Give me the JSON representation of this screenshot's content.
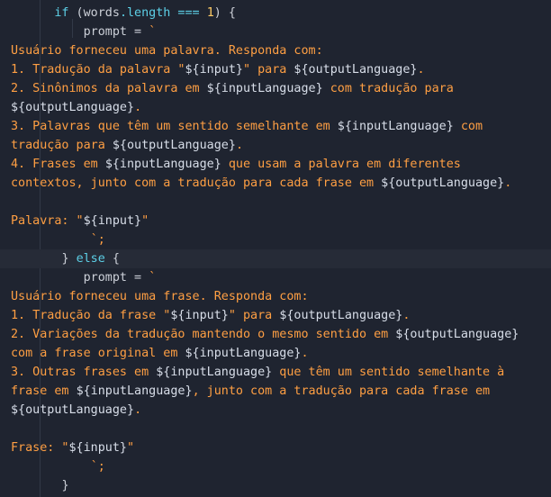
{
  "code": {
    "if_kw": "if",
    "if_cond": " (words",
    "dot": ".",
    "length": "length",
    "eq": " === ",
    "one": "1",
    "if_close": ") {",
    "prompt_assign": "prompt = ",
    "backtick": "`",
    "w_l1": "Usuário forneceu uma palavra. Responda com:",
    "w_l2a": "1. Tradução da palavra \"",
    "w_l2b": "${input}",
    "w_l2c": "\" para ",
    "w_l2d": "${outputLanguage}",
    "w_l2e": ".",
    "w_l3a": "2. Sinônimos da palavra em ",
    "w_l3b": "${inputLanguage}",
    "w_l3c": " com tradução para",
    "w_l4a": "${outputLanguage}",
    "w_l4b": ".",
    "w_l5a": "3. Palavras que têm um sentido semelhante em ",
    "w_l5b": "${inputLanguage}",
    "w_l5c": " com",
    "w_l6a": "tradução para ",
    "w_l6b": "${outputLanguage}",
    "w_l6c": ".",
    "w_l7a": "4. Frases em ",
    "w_l7b": "${inputLanguage}",
    "w_l7c": " que usam a palavra em diferentes",
    "w_l8a": "contextos, junto com a tradução para cada frase em ",
    "w_l8b": "${outputLanguage}",
    "w_l8c": ".",
    "w_word_a": "Palavra: \"",
    "w_word_b": "${input}",
    "w_word_c": "\"",
    "end_tick": "`;",
    "else_close": "} ",
    "else_kw": "else",
    "else_open": " {",
    "f_l1": "Usuário forneceu uma frase. Responda com:",
    "f_l2a": "1. Tradução da frase \"",
    "f_l2b": "${input}",
    "f_l2c": "\" para ",
    "f_l2d": "${outputLanguage}",
    "f_l2e": ".",
    "f_l3a": "2. Variações da tradução mantendo o mesmo sentido em ",
    "f_l3b": "${outputLanguage}",
    "f_l4a": "com a frase original em ",
    "f_l4b": "${inputLanguage}",
    "f_l4c": ".",
    "f_l5a": "3. Outras frases em ",
    "f_l5b": "${inputLanguage}",
    "f_l5c": " que têm um sentido semelhante à",
    "f_l6a": "frase em ",
    "f_l6b": "${inputLanguage}",
    "f_l6c": ", junto com a tradução para cada frase em",
    "f_l7a": "${outputLanguage}",
    "f_l7b": ".",
    "f_word_a": "Frase: \"",
    "f_word_b": "${input}",
    "f_word_c": "\"",
    "close_brace": "}"
  }
}
